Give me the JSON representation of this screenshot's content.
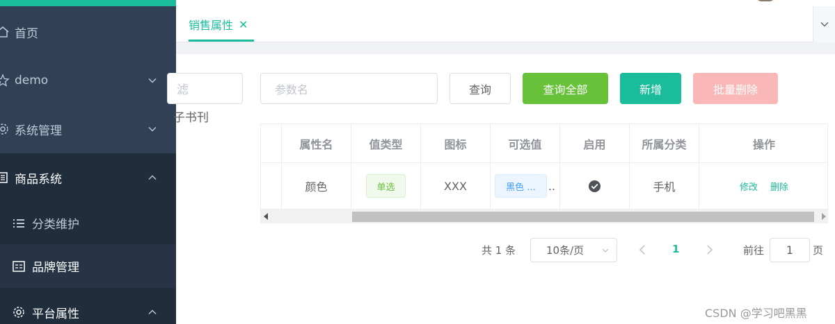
{
  "sidebar": {
    "items": [
      {
        "label": "首页"
      },
      {
        "label": "demo"
      },
      {
        "label": "系统管理"
      },
      {
        "label": "商品系统"
      },
      {
        "label": "分类维护"
      },
      {
        "label": "品牌管理"
      },
      {
        "label": "平台属性"
      }
    ]
  },
  "tabs": [
    {
      "label": "销售属性",
      "close": "✕"
    }
  ],
  "tree": {
    "filter_placeholder": "滤",
    "node_label": "子书刊"
  },
  "search": {
    "placeholder": "参数名",
    "query_label": "查询",
    "query_all_label": "查询全部",
    "add_label": "新增",
    "batch_delete_label": "批量删除"
  },
  "table": {
    "columns": [
      "属性名",
      "值类型",
      "图标",
      "可选值",
      "启用",
      "所属分类",
      "操作"
    ],
    "rows": [
      {
        "name": "颜色",
        "value_type": "单选",
        "icon": "XXX",
        "options": "黑色 ...",
        "options_more": "..",
        "enabled": "check-circle-icon",
        "category": "手机",
        "edit": "修改",
        "delete": "删除"
      }
    ]
  },
  "pagination": {
    "total": "共 1 条",
    "page_size": "10条/页",
    "current": "1",
    "goto_prefix": "前往",
    "goto_value": "1",
    "goto_suffix": "页"
  },
  "watermark": "CSDN @学习吧黑黑",
  "colors": {
    "sidebar_bg": "#304156",
    "accent": "#1abc9c",
    "success": "#67c23a",
    "danger_light": "#f9b7b7"
  }
}
